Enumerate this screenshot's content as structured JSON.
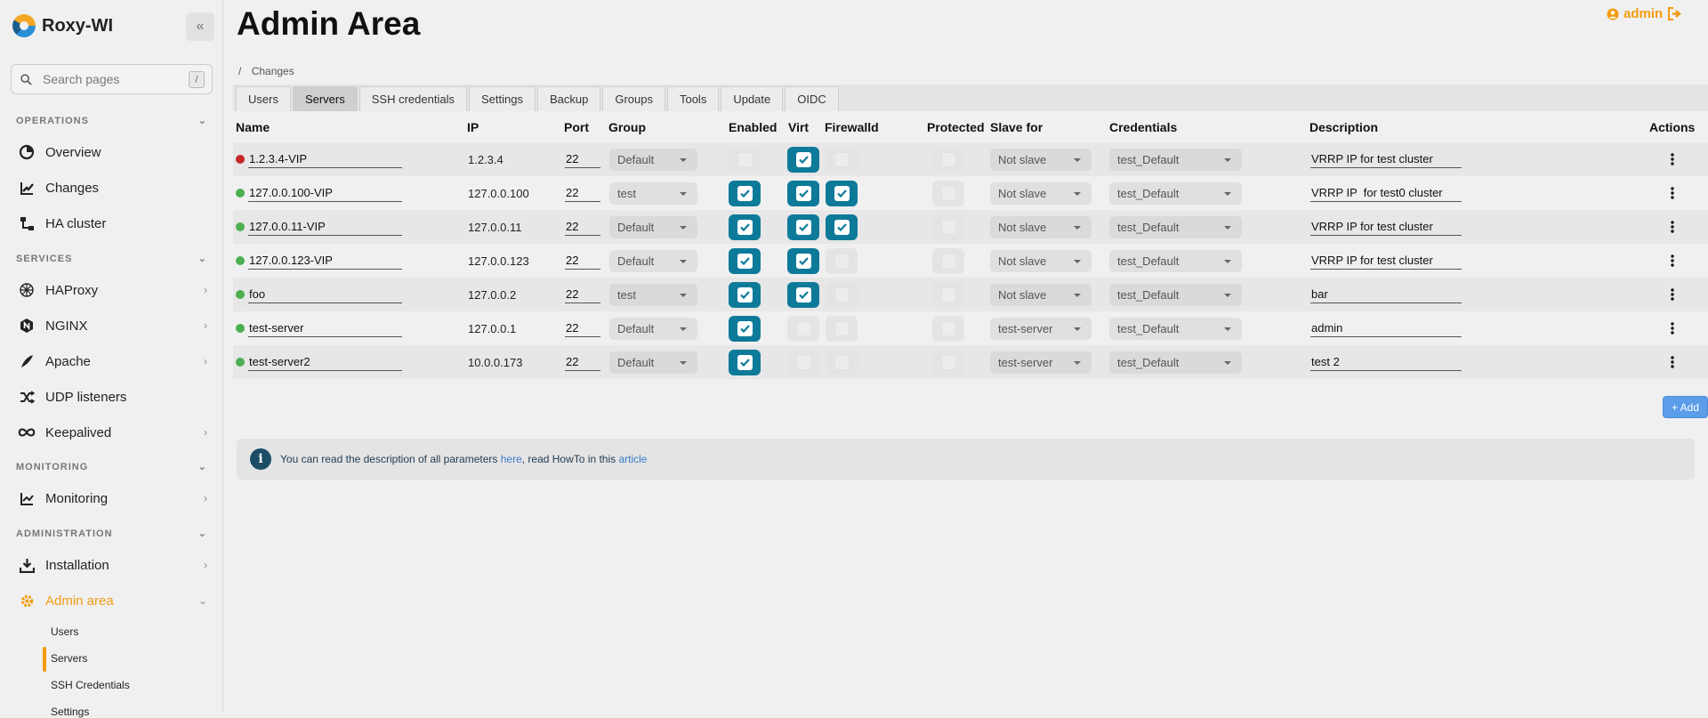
{
  "app": {
    "name": "Roxy-WI",
    "collapse_icon": "«"
  },
  "search": {
    "placeholder": "Search pages",
    "shortcut": "/"
  },
  "sidebar": {
    "sections": {
      "operations": "OPERATIONS",
      "services": "SERVICES",
      "monitoring": "MONITORING",
      "administration": "ADMINISTRATION"
    },
    "items": {
      "overview": "Overview",
      "changes": "Changes",
      "ha_cluster": "HA cluster",
      "haproxy": "HAProxy",
      "nginx": "NGINX",
      "apache": "Apache",
      "udp": "UDP listeners",
      "keepalived": "Keepalived",
      "monitoring": "Monitoring",
      "installation": "Installation",
      "admin_area": "Admin area"
    },
    "sub_items": [
      "Users",
      "Servers",
      "SSH Credentials",
      "Settings"
    ],
    "active_color": "#f39c12"
  },
  "header": {
    "title": "Admin Area",
    "user": "admin"
  },
  "breadcrumb": {
    "separator": "/",
    "current": "Changes"
  },
  "tabs": [
    "Users",
    "Servers",
    "SSH credentials",
    "Settings",
    "Backup",
    "Groups",
    "Tools",
    "Update",
    "OIDC"
  ],
  "active_tab": "Servers",
  "table": {
    "columns": [
      "Name",
      "IP",
      "Port",
      "Group",
      "Enabled",
      "Virt",
      "Firewalld",
      "Protected",
      "Slave for",
      "Credentials",
      "Description",
      "Actions"
    ],
    "rows": [
      {
        "status": "down",
        "name": "1.2.3.4-VIP",
        "ip": "1.2.3.4",
        "port": "22",
        "group": "Default",
        "enabled": false,
        "virt": true,
        "firewalld": false,
        "protected": false,
        "slave_for": "Not slave",
        "credentials": "test_Default",
        "description": "VRRP IP for test cluster"
      },
      {
        "status": "up",
        "name": "127.0.0.100-VIP",
        "ip": "127.0.0.100",
        "port": "22",
        "group": "test",
        "enabled": true,
        "virt": true,
        "firewalld": true,
        "protected": false,
        "slave_for": "Not slave",
        "credentials": "test_Default",
        "description": "VRRP IP  for test0 cluster"
      },
      {
        "status": "up",
        "name": "127.0.0.11-VIP",
        "ip": "127.0.0.11",
        "port": "22",
        "group": "Default",
        "enabled": true,
        "virt": true,
        "firewalld": true,
        "protected": false,
        "slave_for": "Not slave",
        "credentials": "test_Default",
        "description": "VRRP IP for test cluster"
      },
      {
        "status": "up",
        "name": "127.0.0.123-VIP",
        "ip": "127.0.0.123",
        "port": "22",
        "group": "Default",
        "enabled": true,
        "virt": true,
        "firewalld": false,
        "protected": false,
        "slave_for": "Not slave",
        "credentials": "test_Default",
        "description": "VRRP IP for test cluster"
      },
      {
        "status": "up",
        "name": "foo",
        "ip": "127.0.0.2",
        "port": "22",
        "group": "test",
        "enabled": true,
        "virt": true,
        "firewalld": false,
        "protected": false,
        "slave_for": "Not slave",
        "credentials": "test_Default",
        "description": "bar"
      },
      {
        "status": "up",
        "name": "test-server",
        "ip": "127.0.0.1",
        "port": "22",
        "group": "Default",
        "enabled": true,
        "virt": false,
        "firewalld": false,
        "protected": false,
        "slave_for": "test-server",
        "credentials": "test_Default",
        "description": "admin"
      },
      {
        "status": "up",
        "name": "test-server2",
        "ip": "10.0.0.173",
        "port": "22",
        "group": "Default",
        "enabled": true,
        "virt": false,
        "firewalld": false,
        "protected": false,
        "slave_for": "test-server",
        "credentials": "test_Default",
        "description": "test 2"
      }
    ]
  },
  "colors": {
    "status_up": "#4caf50",
    "status_down": "#c62828",
    "checkbox_on": "#0e7a9a",
    "accent": "#f39c12",
    "link": "#3a7bc8"
  },
  "add_button": "+ Add",
  "info": {
    "text_before": "You can read the description of all parameters ",
    "link1": "here",
    "text_middle": ", read HowTo in this ",
    "link2": "article"
  }
}
